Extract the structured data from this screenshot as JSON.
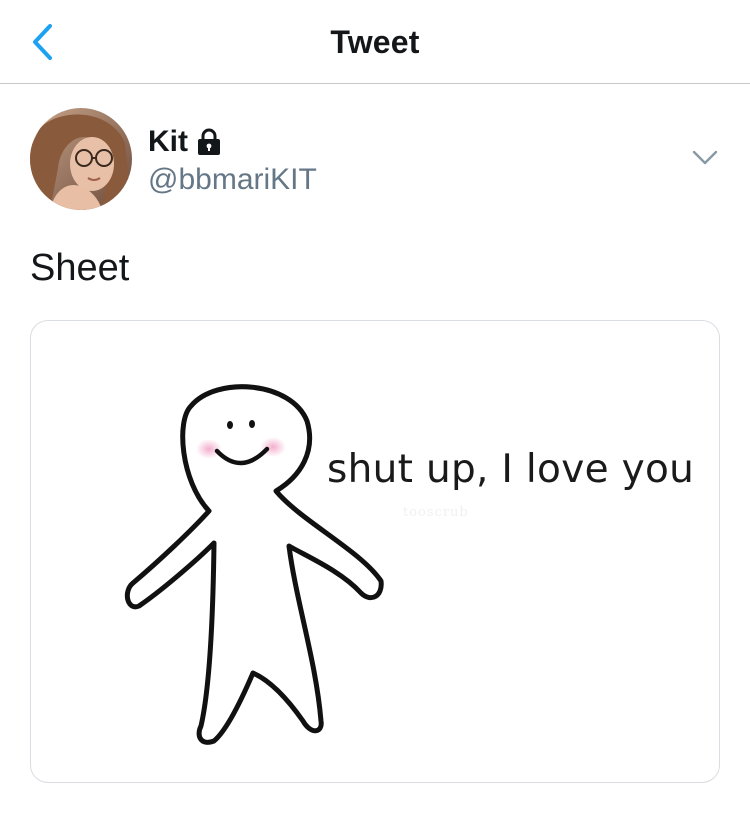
{
  "nav": {
    "title": "Tweet",
    "back_icon": "chevron-left-icon",
    "accent_color": "#1DA1F2"
  },
  "author": {
    "display_name": "Kit",
    "protected_icon": "lock-icon",
    "handle": "@bbmariKIT",
    "more_icon": "chevron-down-icon"
  },
  "tweet": {
    "text": "Sheet"
  },
  "media": {
    "caption": "shut up, I love you",
    "watermark": "tooscrub"
  }
}
